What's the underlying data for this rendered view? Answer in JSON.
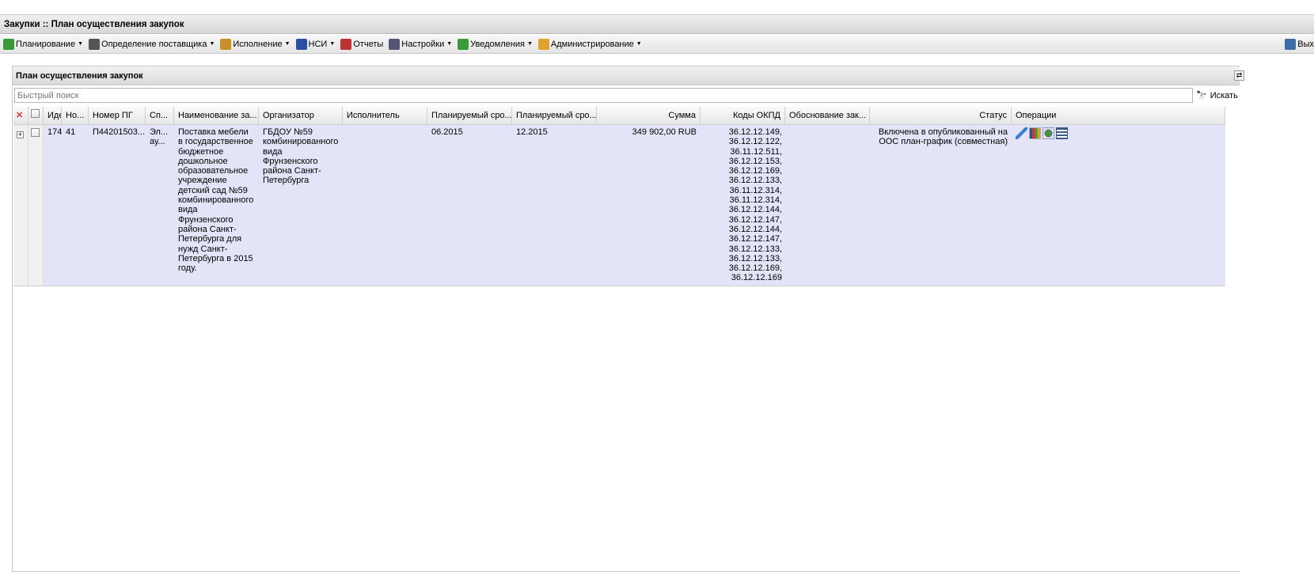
{
  "app": {
    "title": "Закупки :: План осуществления закупок"
  },
  "menu": [
    {
      "label": "Планирование",
      "icon": "planning-icon",
      "dropdown": true
    },
    {
      "label": "Определение поставщика",
      "icon": "gears-icon",
      "dropdown": true
    },
    {
      "label": "Исполнение",
      "icon": "execution-icon",
      "dropdown": true
    },
    {
      "label": "НСИ",
      "icon": "book-icon",
      "dropdown": true
    },
    {
      "label": "Отчеты",
      "icon": "report-icon",
      "dropdown": false
    },
    {
      "label": "Настройки",
      "icon": "wrench-icon",
      "dropdown": true
    },
    {
      "label": "Уведомления",
      "icon": "notification-icon",
      "dropdown": true
    },
    {
      "label": "Администрирование",
      "icon": "user-icon",
      "dropdown": true
    }
  ],
  "exit_label": "Вых",
  "panel": {
    "title": "План осуществления закупок",
    "search_placeholder": "Быстрый поиск",
    "search_button": "Искать"
  },
  "columns": [
    "Иде",
    "Но...",
    "Номер ПГ",
    "Сп...",
    "Наименование за...",
    "Организатор",
    "Исполнитель",
    "Планируемый сро...",
    "Планируемый сро...",
    "Сумма",
    "Коды ОКПД",
    "Обоснование зак...",
    "Статус",
    "Операции"
  ],
  "rows": [
    {
      "id": "174",
      "num": "41",
      "pg": "П44201503...",
      "method": "Эл... ау...",
      "name": "Поставка мебели в государственное бюджетное дошкольное образовательное учреждение детский сад №59 комбинированного вида Фрунзенского района Санкт-Петербурга для нужд Санкт-Петербурга в 2015 году.",
      "organizer": "ГБДОУ №59 комбинированного вида Фрунзенского района Санкт-Петербурга",
      "executor": "",
      "start": "06.2015",
      "end": "12.2015",
      "sum": "349 902,00 RUB",
      "okpd": "36.12.12.149, 36.12.12.122, 36.11.12.511, 36.12.12.153, 36.12.12.169, 36.12.12.133, 36.11.12.314, 36.11.12.314, 36.12.12.144, 36.12.12.147, 36.12.12.144, 36.12.12.147, 36.12.12.133, 36.12.12.133, 36.12.12.169, 36.12.12.169",
      "basis": "",
      "status": "Включена в опубликованный на ООС план-график (совместная)"
    }
  ],
  "colors": {
    "row_bg": "#e4e4f8"
  }
}
